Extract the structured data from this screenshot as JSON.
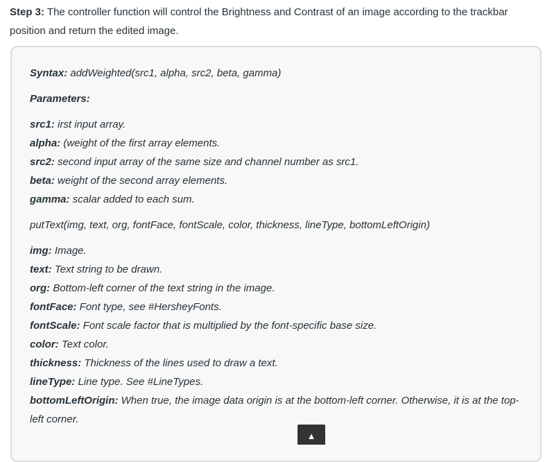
{
  "step": {
    "label": "Step 3:",
    "text": " The controller function will control the Brightness and Contrast of an image according to the trackbar position and return the edited image."
  },
  "syntax": {
    "label": "Syntax:",
    "text": " addWeighted(src1, alpha, src2, beta, gamma)"
  },
  "parameters_label": "Parameters:",
  "params1": [
    {
      "name": "src1:",
      "desc": " irst input array."
    },
    {
      "name": "alpha:",
      "desc": " (weight of the first array elements."
    },
    {
      "name": "src2:",
      "desc": " second input array of the same size and channel number as src1."
    },
    {
      "name": "beta:",
      "desc": " weight of the second array elements."
    },
    {
      "name": "gamma:",
      "desc": " scalar added to each sum."
    }
  ],
  "puttext_signature": "putText(img, text, org, fontFace, fontScale, color, thickness, lineType, bottomLeftOrigin)",
  "params2": [
    {
      "name": "img:",
      "desc": " Image."
    },
    {
      "name": "text:",
      "desc": " Text string to be drawn."
    },
    {
      "name": "org:",
      "desc": " Bottom-left corner of the text string in the image."
    },
    {
      "name": "fontFace:",
      "desc": " Font type, see #HersheyFonts."
    },
    {
      "name": "fontScale:",
      "desc": " Font scale factor that is multiplied by the font-specific base size."
    },
    {
      "name": "color:",
      "desc": " Text color."
    },
    {
      "name": "thickness:",
      "desc": " Thickness of the lines used to draw a text."
    },
    {
      "name": "lineType:",
      "desc": " Line type. See #LineTypes."
    },
    {
      "name": "bottomLeftOrigin:",
      "desc": " When true, the image data origin is at the bottom-left corner. Otherwise, it is at the top-left corner."
    }
  ],
  "scroll_top_glyph": "▲"
}
